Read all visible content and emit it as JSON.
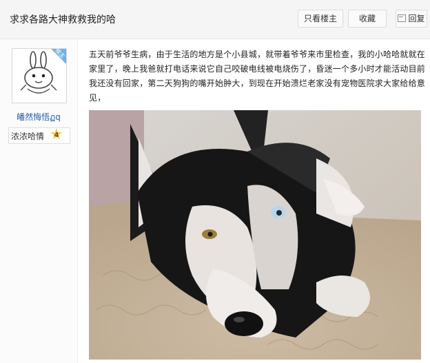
{
  "header": {
    "title": "求求各路大神救救我的哈",
    "only_op_label": "只看楼主",
    "favorite_label": "收藏",
    "reply_label": "回复"
  },
  "author": {
    "badge": "楼主",
    "username": "皤然悔悟ฏq",
    "level_name": "浓浓哈情",
    "level_number": "4"
  },
  "post": {
    "paragraph": "五天前爷爷生病，由于生活的地方是个小县城，就带着爷爷来市里检查，我的小哈哈就就在家里了，晚上我爸就打电话来说它自己咬破电线被电烧伤了，昏迷一个多小时才能活动目前我还没有回家，第二天狗狗的嘴开始肿大，到现在开始溃烂老家没有宠物医院求大家给给意见，"
  },
  "colors": {
    "accent_link": "#2a5fb0",
    "badge_blue": "#6db3e8",
    "header_bg": "#f5f5f5"
  }
}
